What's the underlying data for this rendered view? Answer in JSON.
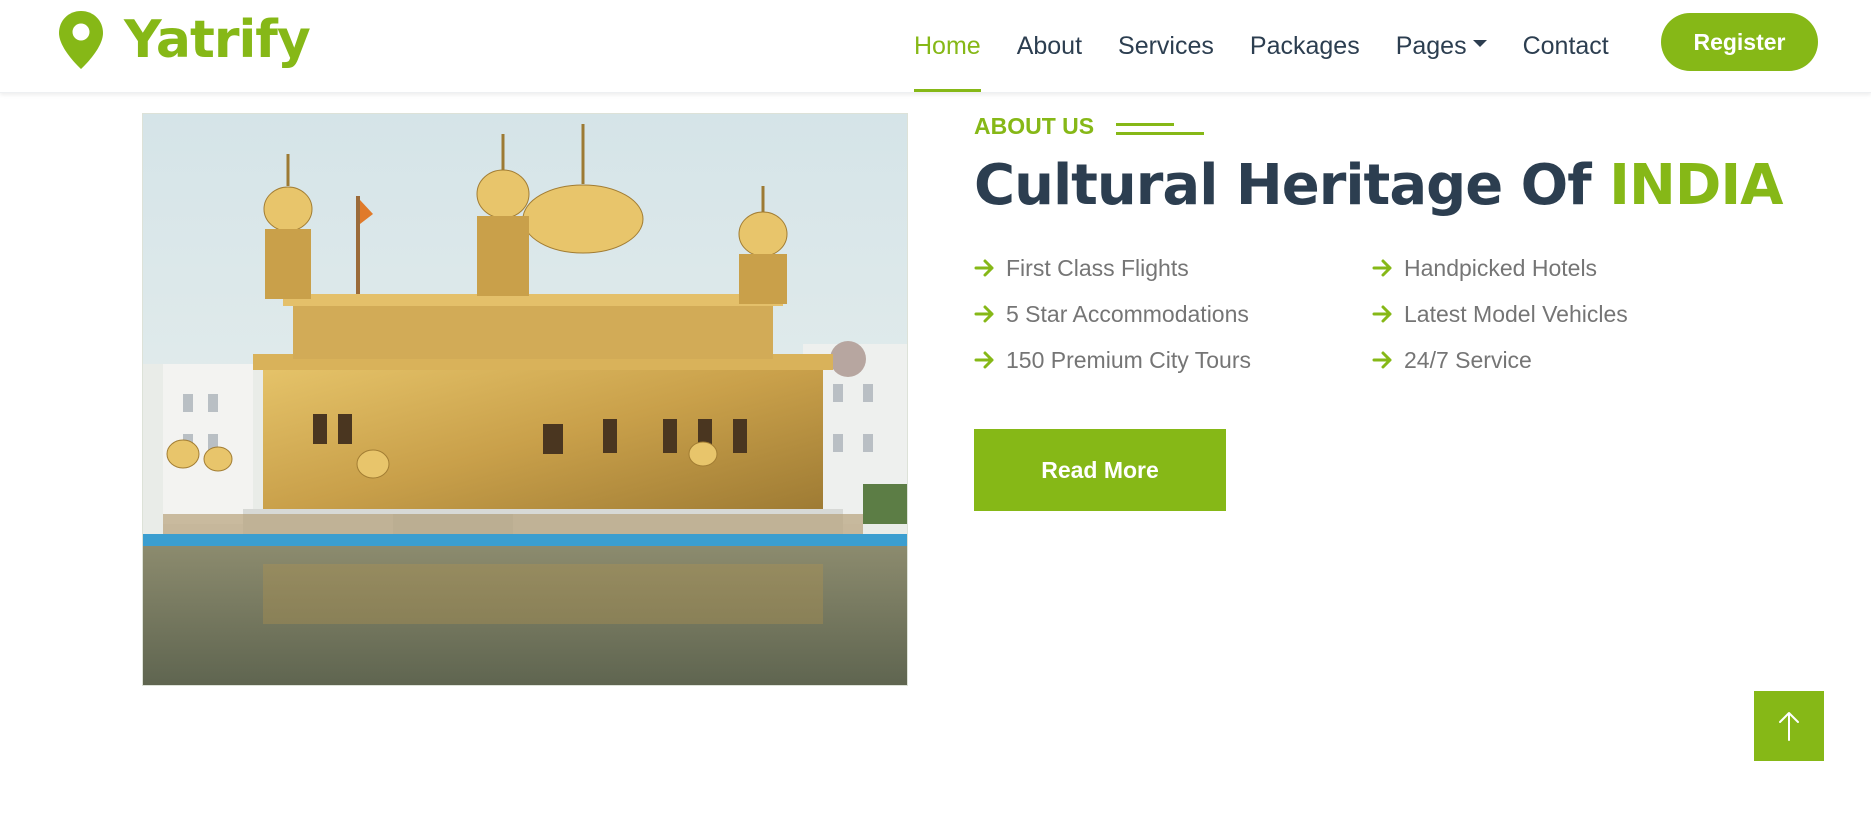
{
  "brand": {
    "name": "Yatrify",
    "icon": "map-pin-icon",
    "color": "#86b817"
  },
  "nav": {
    "home": "Home",
    "about": "About",
    "services": "Services",
    "packages": "Packages",
    "pages": "Pages",
    "contact": "Contact",
    "active": "Home"
  },
  "register_label": "Register",
  "about": {
    "eyebrow": "ABOUT US",
    "heading_main": "Cultural Heritage Of ",
    "heading_accent": "INDIA",
    "features": [
      "First Class Flights",
      "Handpicked Hotels",
      "5 Star Accommodations",
      "Latest Model Vehicles",
      "150 Premium City Tours",
      "24/7 Service"
    ],
    "read_more": "Read More"
  },
  "colors": {
    "accent": "#86b817",
    "heading": "#2c3e50",
    "text": "#757575"
  },
  "icons": {
    "feature": "arrow-right-icon",
    "back_to_top": "arrow-up-icon",
    "dropdown": "caret-down-icon"
  }
}
